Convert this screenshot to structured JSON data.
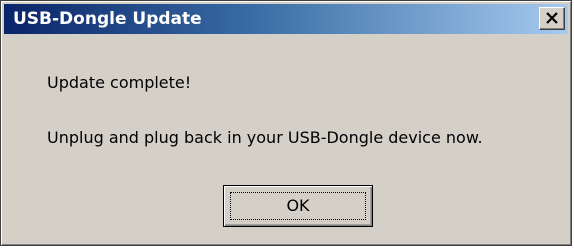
{
  "dialog": {
    "title": "USB-Dongle Update",
    "close_label": "X",
    "message_line1": "Update complete!",
    "message_line2": "Unplug and plug back in your USB-Dongle device now.",
    "ok_label": "OK"
  },
  "colors": {
    "titlebar_start": "#0a246a",
    "titlebar_end": "#a6caf0",
    "window_bg": "#d4d0c8"
  },
  "icons": {
    "close": "close-icon"
  }
}
